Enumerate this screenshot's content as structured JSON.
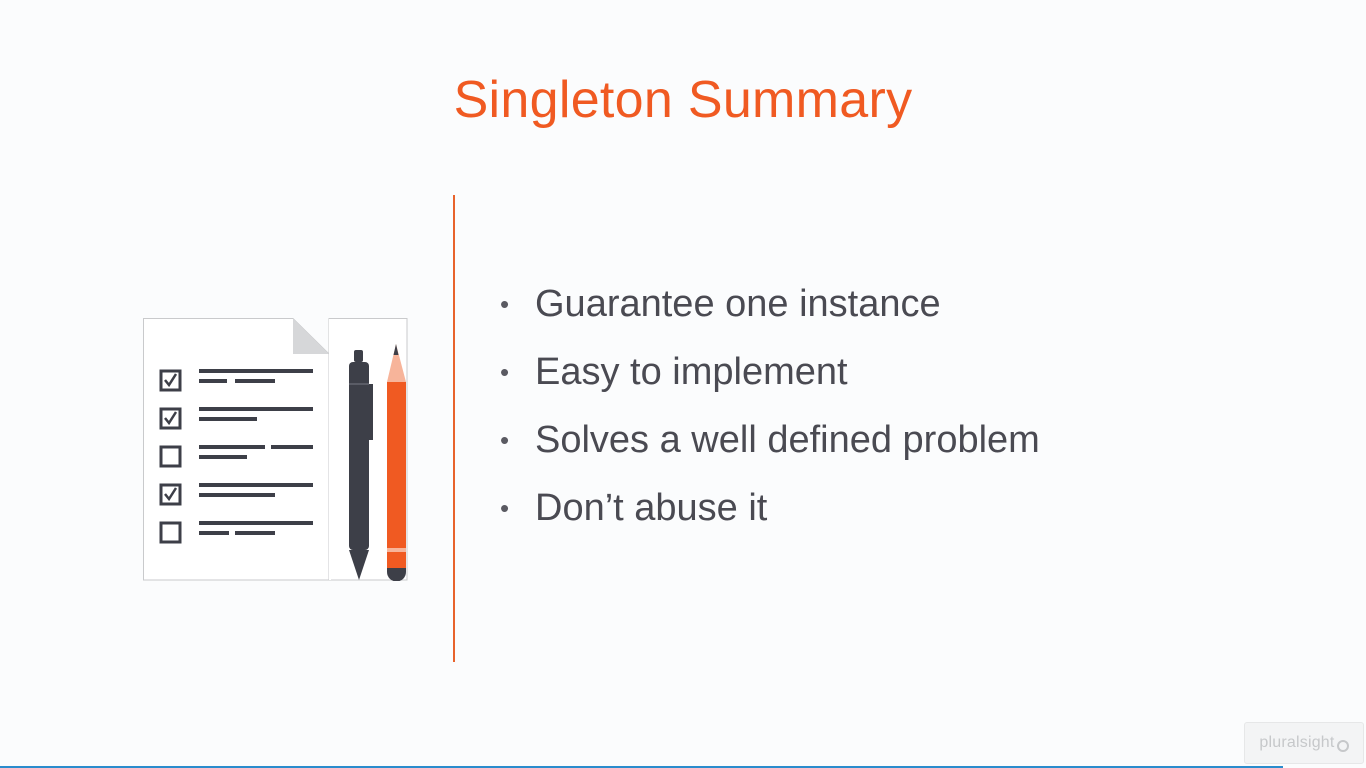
{
  "slide": {
    "title": "Singleton Summary",
    "bullets": [
      "Guarantee one instance",
      "Easy to implement",
      "Solves a well defined problem",
      "Don’t abuse it"
    ]
  },
  "illustration": {
    "icon": "checklist-with-pen-and-pencil-icon",
    "checkboxes": [
      true,
      true,
      false,
      true,
      false
    ]
  },
  "branding": {
    "logo_text": "pluralsight"
  },
  "colors": {
    "accent": "#f05a22",
    "text": "#4a4a52",
    "background": "#fbfcfd",
    "icon_dark": "#3d3f48",
    "progress": "#2a8ccd"
  }
}
